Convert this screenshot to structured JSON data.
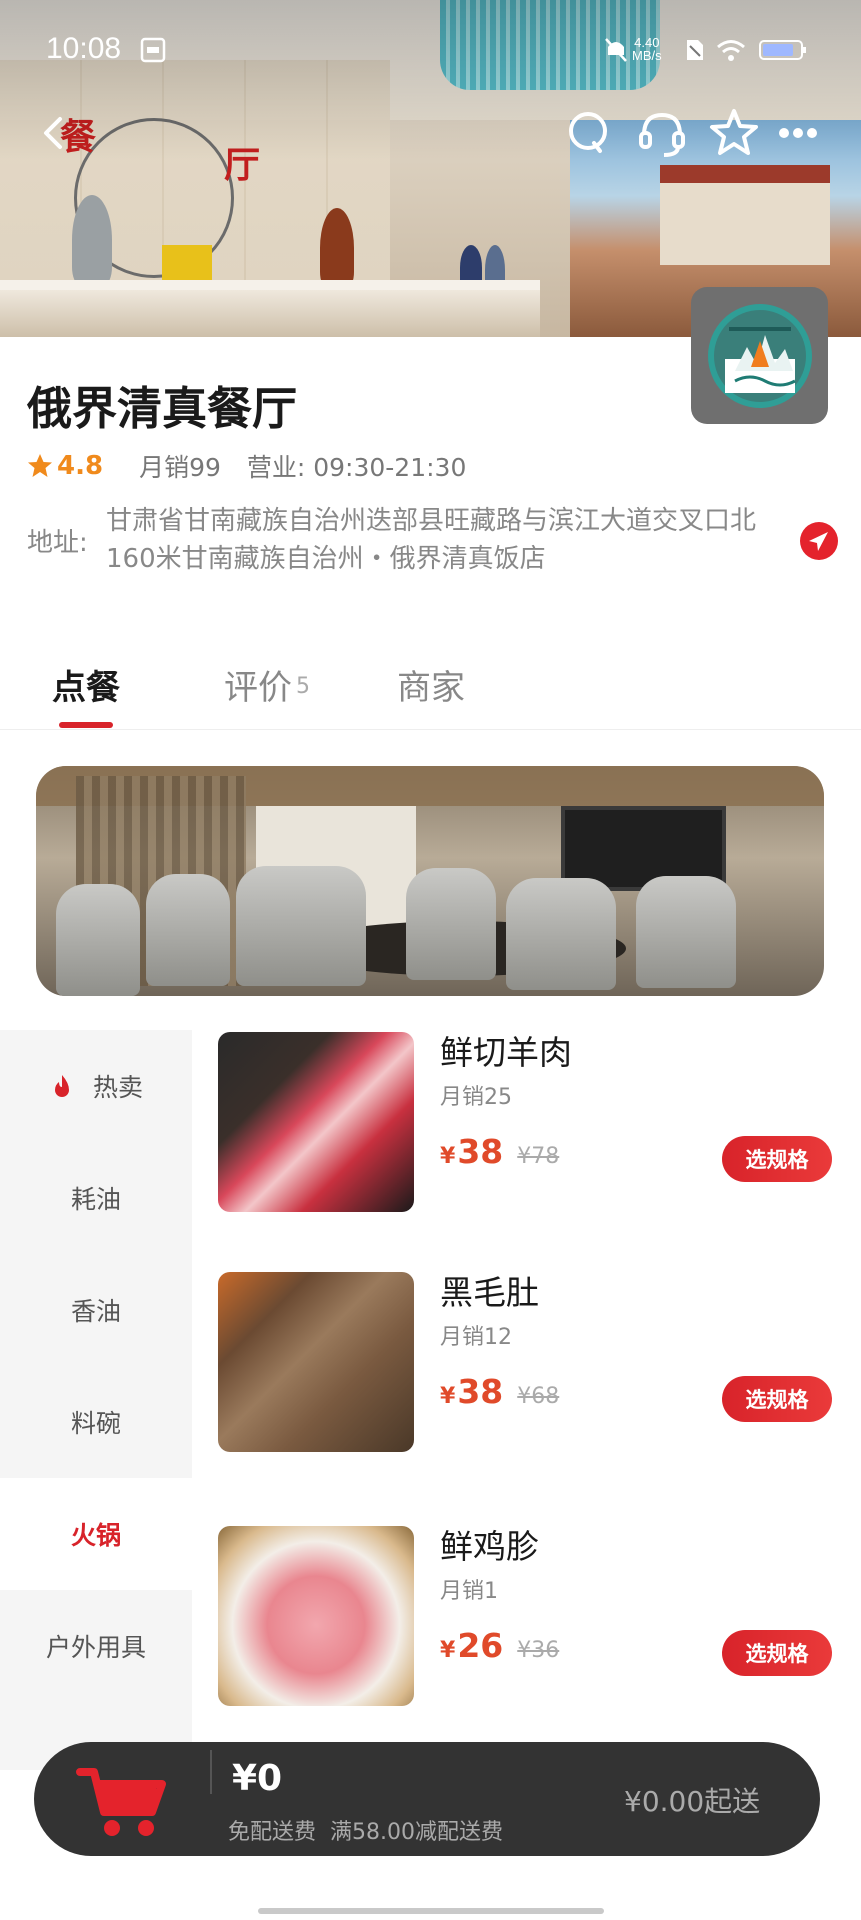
{
  "status_bar": {
    "time": "10:08",
    "net_speed_value": "4.40",
    "net_speed_unit": "MB/s"
  },
  "hero": {
    "sign_char_1": "餐",
    "sign_char_2": "厅"
  },
  "store": {
    "name": "俄界清真餐厅",
    "rating": "4.8",
    "monthly_sales": "月销99",
    "hours": "营业: 09:30-21:30",
    "address_label": "地址:",
    "address": "甘肃省甘南藏族自治州迭部县旺藏路与滨江大道交叉口北160米甘南藏族自治州・俄界清真饭店"
  },
  "tabs": [
    {
      "label": "点餐",
      "active": true
    },
    {
      "label": "评价",
      "count": "5"
    },
    {
      "label": "商家"
    }
  ],
  "categories": [
    {
      "label": "热卖",
      "icon": "flame-icon"
    },
    {
      "label": "耗油"
    },
    {
      "label": "香油"
    },
    {
      "label": "料碗"
    },
    {
      "label": "火锅",
      "active": true
    },
    {
      "label": "户外用具"
    }
  ],
  "products": [
    {
      "name": "鲜切羊肉",
      "sales": "月销25",
      "currency": "¥",
      "price": "38",
      "original_price": "¥78",
      "button": "选规格"
    },
    {
      "name": "黑毛肚",
      "sales": "月销12",
      "currency": "¥",
      "price": "38",
      "original_price": "¥68",
      "button": "选规格"
    },
    {
      "name": "鲜鸡胗",
      "sales": "月销1",
      "currency": "¥",
      "price": "26",
      "original_price": "¥36",
      "button": "选规格"
    }
  ],
  "cart": {
    "total": "¥0",
    "free_delivery": "免配送费",
    "promo": "满58.00减配送费",
    "min_order": "¥0.00起送"
  },
  "colors": {
    "accent": "#d8232a",
    "price": "#e04a2a",
    "rating": "#f08a1c",
    "cart_bar": "#333333"
  }
}
